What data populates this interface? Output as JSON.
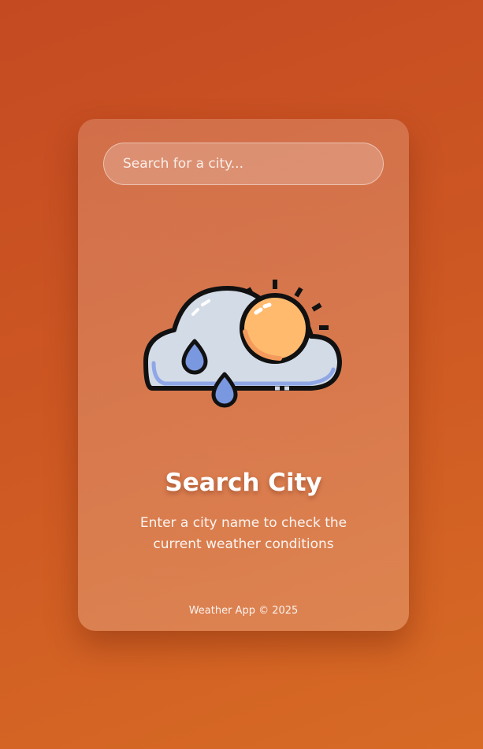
{
  "search": {
    "placeholder": "Search for a city...",
    "value": ""
  },
  "main": {
    "icon": "cloud-sun-rain-icon",
    "title": "Search City",
    "description": "Enter a city name to check the current weather conditions"
  },
  "footer": {
    "text": "Weather App © 2025"
  },
  "colors": {
    "background": "#c94f22",
    "card": "#d37a55",
    "text": "#ffffff",
    "cloud": "#d3dbe7",
    "sun": "#ffba6e",
    "rain": "#7a98e0"
  }
}
